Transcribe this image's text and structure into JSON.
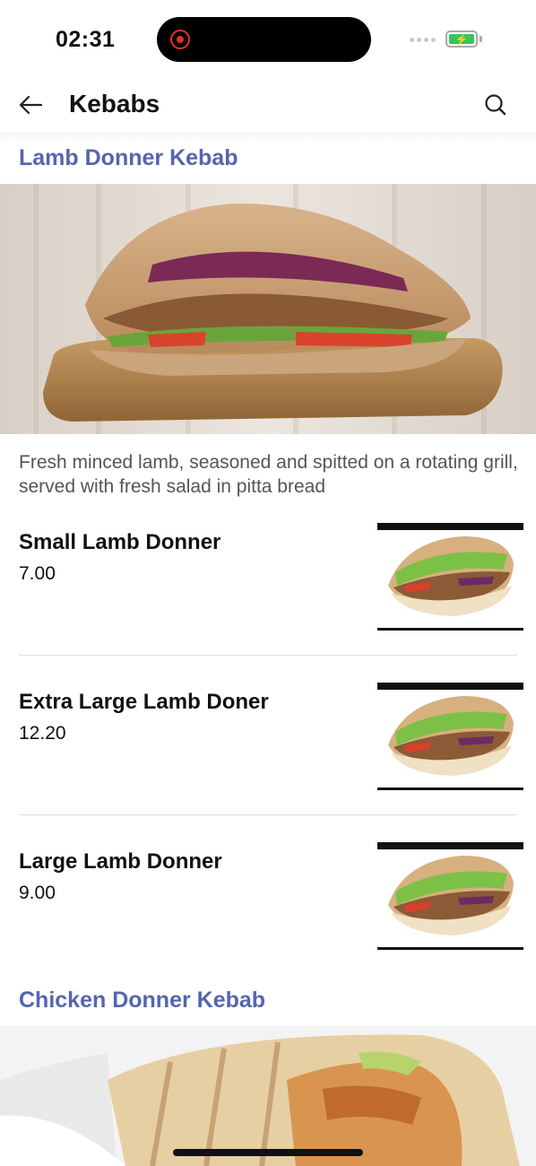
{
  "status_bar": {
    "time": "02:31",
    "recording_indicator": "red-record-dot",
    "battery_state": "charging"
  },
  "header": {
    "title": "Kebabs",
    "back_icon": "back-arrow-icon",
    "search_icon": "search-icon"
  },
  "sections": [
    {
      "title": "Lamb Donner Kebab",
      "description": "Fresh minced lamb, seasoned and spitted on a rotating grill, served with fresh salad in pitta bread",
      "items": [
        {
          "name": "Small Lamb Donner",
          "price": "7.00"
        },
        {
          "name": "Extra Large Lamb Doner",
          "price": "12.20"
        },
        {
          "name": "Large Lamb Donner",
          "price": "9.00"
        }
      ]
    },
    {
      "title": "Chicken Donner Kebab"
    }
  ],
  "colors": {
    "section_title": "#5565ad",
    "text": "#111111",
    "description": "#555555",
    "divider": "#dcdcdc"
  }
}
